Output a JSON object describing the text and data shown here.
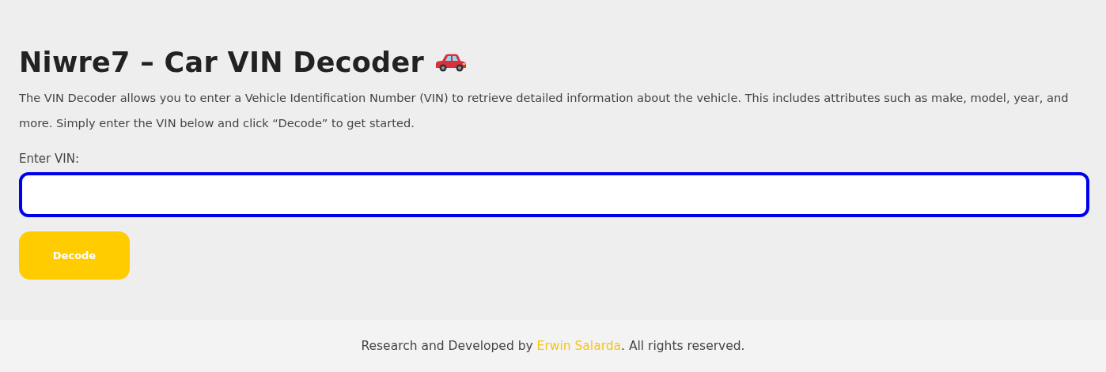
{
  "title": "Niwre7 – Car VIN Decoder",
  "description": "The VIN Decoder allows you to enter a Vehicle Identification Number (VIN) to retrieve detailed information about the vehicle. This includes attributes such as make, model, year, and more. Simply enter the VIN below and click “Decode” to get started.",
  "vin_field": {
    "label": "Enter VIN:",
    "focused": true
  },
  "decode_button": {
    "label": "Decode"
  },
  "footer": {
    "text_before": "Research and Developed by ",
    "link": "Erwin Salarda",
    "text_after": ". All rights reserved."
  }
}
